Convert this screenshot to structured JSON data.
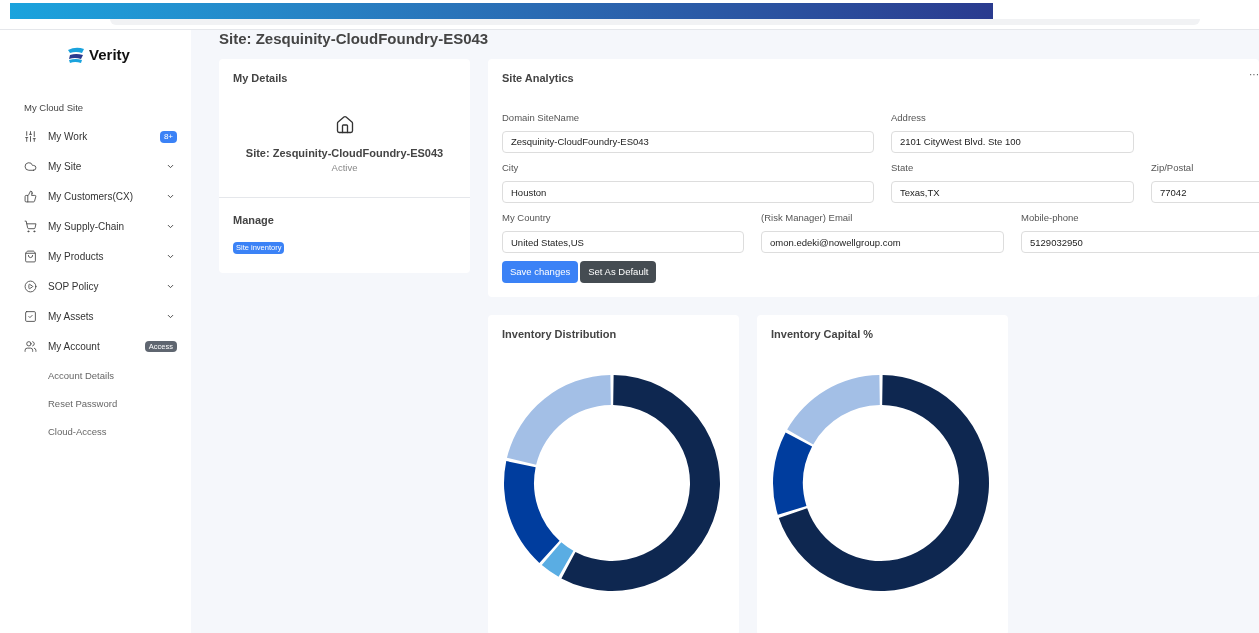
{
  "sidebar": {
    "logo": "Verity",
    "section_title": "My Cloud Site",
    "items": [
      {
        "label": "My Work",
        "expandable": false,
        "badge": {
          "text": "8+",
          "kind": "count"
        }
      },
      {
        "label": "My Site",
        "expandable": true
      },
      {
        "label": "My Customers(CX)",
        "expandable": true
      },
      {
        "label": "My Supply-Chain",
        "expandable": true
      },
      {
        "label": "My Products",
        "expandable": true
      },
      {
        "label": "SOP Policy",
        "expandable": true
      },
      {
        "label": "My Assets",
        "expandable": true
      },
      {
        "label": "My Account",
        "expandable": false,
        "badge": {
          "text": "Access",
          "kind": "tag"
        },
        "children": [
          {
            "label": "Account Details"
          },
          {
            "label": "Reset Password"
          },
          {
            "label": "Cloud-Access"
          }
        ]
      }
    ]
  },
  "page_title": "Site: Zesquinity-CloudFoundry-ES043",
  "details_card": {
    "title": "My Details",
    "site_name": "Site: Zesquinity-CloudFoundry-ES043",
    "status": "Active",
    "manage_title": "Manage",
    "manage_badge": "Site inventory"
  },
  "analytics_card": {
    "title": "Site Analytics",
    "more": "···",
    "rows": [
      [
        {
          "label": "Domain SiteName",
          "value": "Zesquinity-CloudFoundry-ES043"
        },
        {
          "label": "Address",
          "value": "2101 CityWest Blvd. Ste 100"
        }
      ],
      [
        {
          "label": "City",
          "value": "Houston"
        },
        {
          "label": "State",
          "value": "Texas,TX"
        },
        {
          "label": "Zip/Postal",
          "value": "77042"
        }
      ],
      [
        {
          "label": "My Country",
          "value": "United States,US"
        },
        {
          "label": "(Risk Manager) Email",
          "value": "omon.edeki@nowellgroup.com"
        },
        {
          "label": "Mobile-phone",
          "value": "5129032950"
        }
      ]
    ],
    "buttons": [
      {
        "label": "Save changes",
        "kind": "primary"
      },
      {
        "label": "Set As Default",
        "kind": "secondary"
      }
    ]
  },
  "charts": [
    {
      "title": "Inventory Distribution"
    },
    {
      "title": "Inventory Capital %"
    }
  ]
}
